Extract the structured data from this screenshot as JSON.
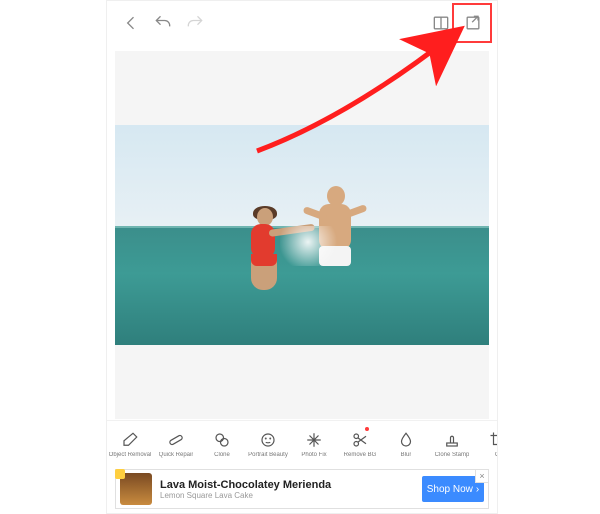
{
  "topbar": {
    "back": "back",
    "undo": "undo",
    "redo": "redo",
    "compare": "compare",
    "export": "export"
  },
  "tools": [
    {
      "name": "object-removal",
      "label": "Object Removal",
      "icon": "eraser",
      "dot": false
    },
    {
      "name": "quick-repair",
      "label": "Quick Repair",
      "icon": "bandage",
      "dot": false
    },
    {
      "name": "clone",
      "label": "Clone",
      "icon": "clone",
      "dot": false
    },
    {
      "name": "portrait-beauty",
      "label": "Portrait Beauty",
      "icon": "face",
      "dot": false
    },
    {
      "name": "photo-fix",
      "label": "Photo Fix",
      "icon": "sparkle",
      "dot": false
    },
    {
      "name": "remove-bg",
      "label": "Remove BG",
      "icon": "scissors",
      "dot": true
    },
    {
      "name": "blur",
      "label": "Blur",
      "icon": "blur",
      "dot": false
    },
    {
      "name": "clone-stamp",
      "label": "Clone Stamp",
      "icon": "stamp",
      "dot": false
    },
    {
      "name": "crop",
      "label": "Cr",
      "icon": "crop",
      "dot": false
    }
  ],
  "ad": {
    "title": "Lava Moist-Chocolatey Merienda",
    "subtitle": "Lemon Square Lava Cake",
    "cta": "Shop Now",
    "cta_arrow": "›"
  },
  "annotation": {
    "highlight": "export-button"
  }
}
